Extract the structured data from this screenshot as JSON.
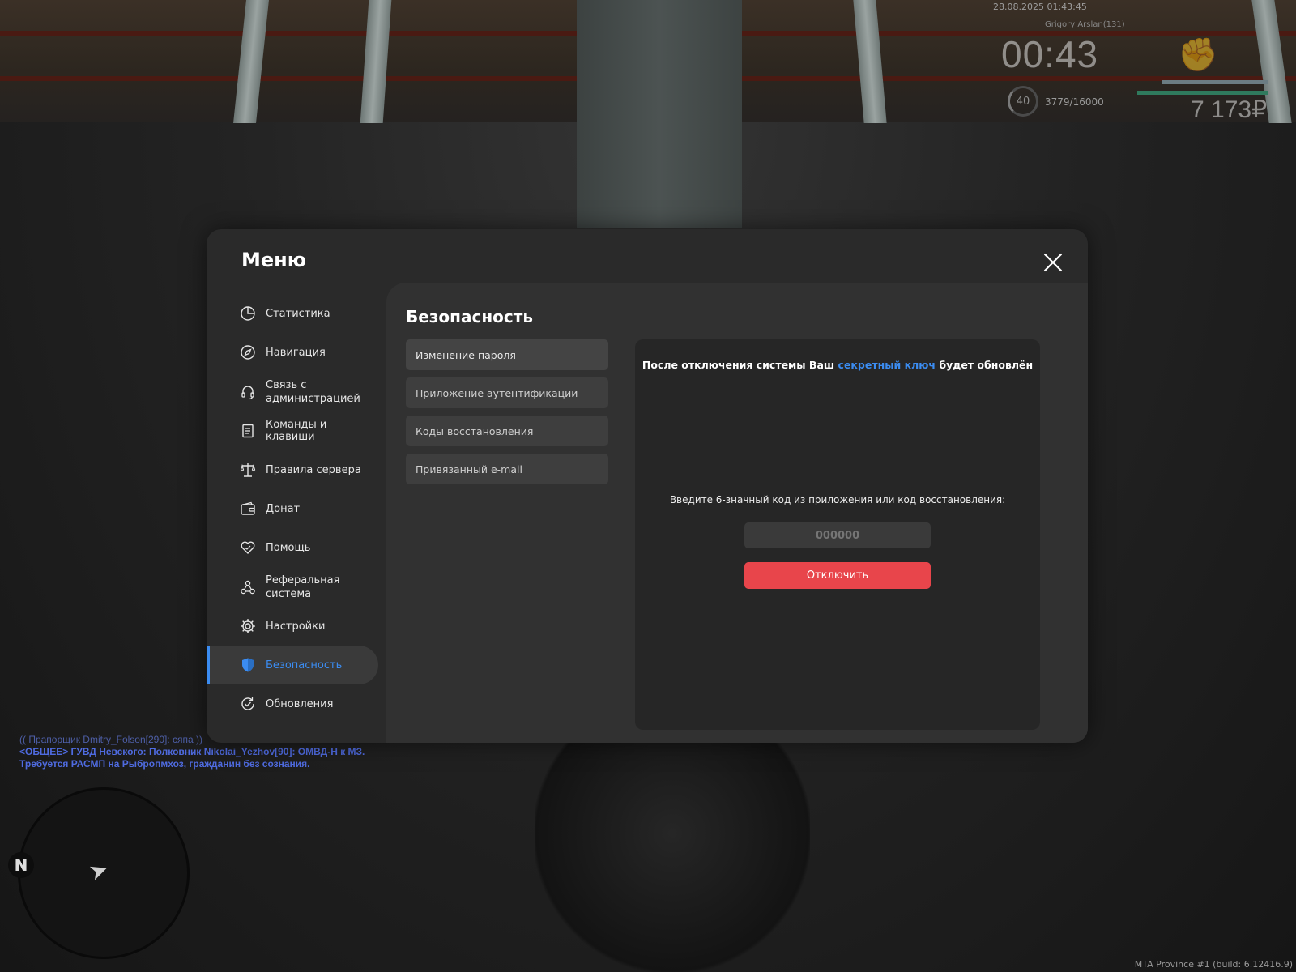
{
  "hud": {
    "datetime": "28.08.2025 01:43:45",
    "nickname": "Grigory Arslan(131)",
    "timer": "00:43",
    "level": "40",
    "experience": "3779/16000",
    "money": "7 173₽"
  },
  "chat": {
    "line1": "(( Прапорщик Dmitry_Folson[290]: сяпа ))",
    "line2": "<ОБЩЕЕ> ГУВД Невского: Полковник Nikolai_Yezhov[90]: ОМВД-Н к МЗ. Требуется РАСМП на Рыбропмхоз, гражданин без сознания."
  },
  "radar": {
    "north_label": "N"
  },
  "build": "MTA Province #1 (build: 6.12416.9)",
  "menu": {
    "title": "Меню",
    "close_icon": "close-icon",
    "nav": [
      {
        "label": "Статистика",
        "icon": "pie-chart-icon"
      },
      {
        "label": "Навигация",
        "icon": "compass-icon"
      },
      {
        "label": "Связь с администрацией",
        "icon": "headset-icon"
      },
      {
        "label": "Команды и клавиши",
        "icon": "document-icon"
      },
      {
        "label": "Правила сервера",
        "icon": "scales-icon"
      },
      {
        "label": "Донат",
        "icon": "wallet-icon"
      },
      {
        "label": "Помощь",
        "icon": "handshake-heart-icon"
      },
      {
        "label": "Реферальная система",
        "icon": "network-icon"
      },
      {
        "label": "Настройки",
        "icon": "gear-icon"
      },
      {
        "label": "Безопасность",
        "icon": "shield-icon",
        "active": true
      },
      {
        "label": "Обновления",
        "icon": "refresh-check-icon"
      }
    ],
    "accent_color": "#3b8cf1"
  },
  "security": {
    "title": "Безопасность",
    "tabs": [
      "Изменение пароля",
      "Приложение аутентификации",
      "Коды восстановления",
      "Привязанный e-mail"
    ],
    "notice_before": "После отключения системы Ваш ",
    "notice_link": "секретный ключ",
    "notice_after": " будет обновлён",
    "prompt": "Введите 6-значный код из приложения или код восстановления:",
    "code_placeholder": "000000",
    "disable_button": "Отключить",
    "disable_color": "#e8454b"
  }
}
